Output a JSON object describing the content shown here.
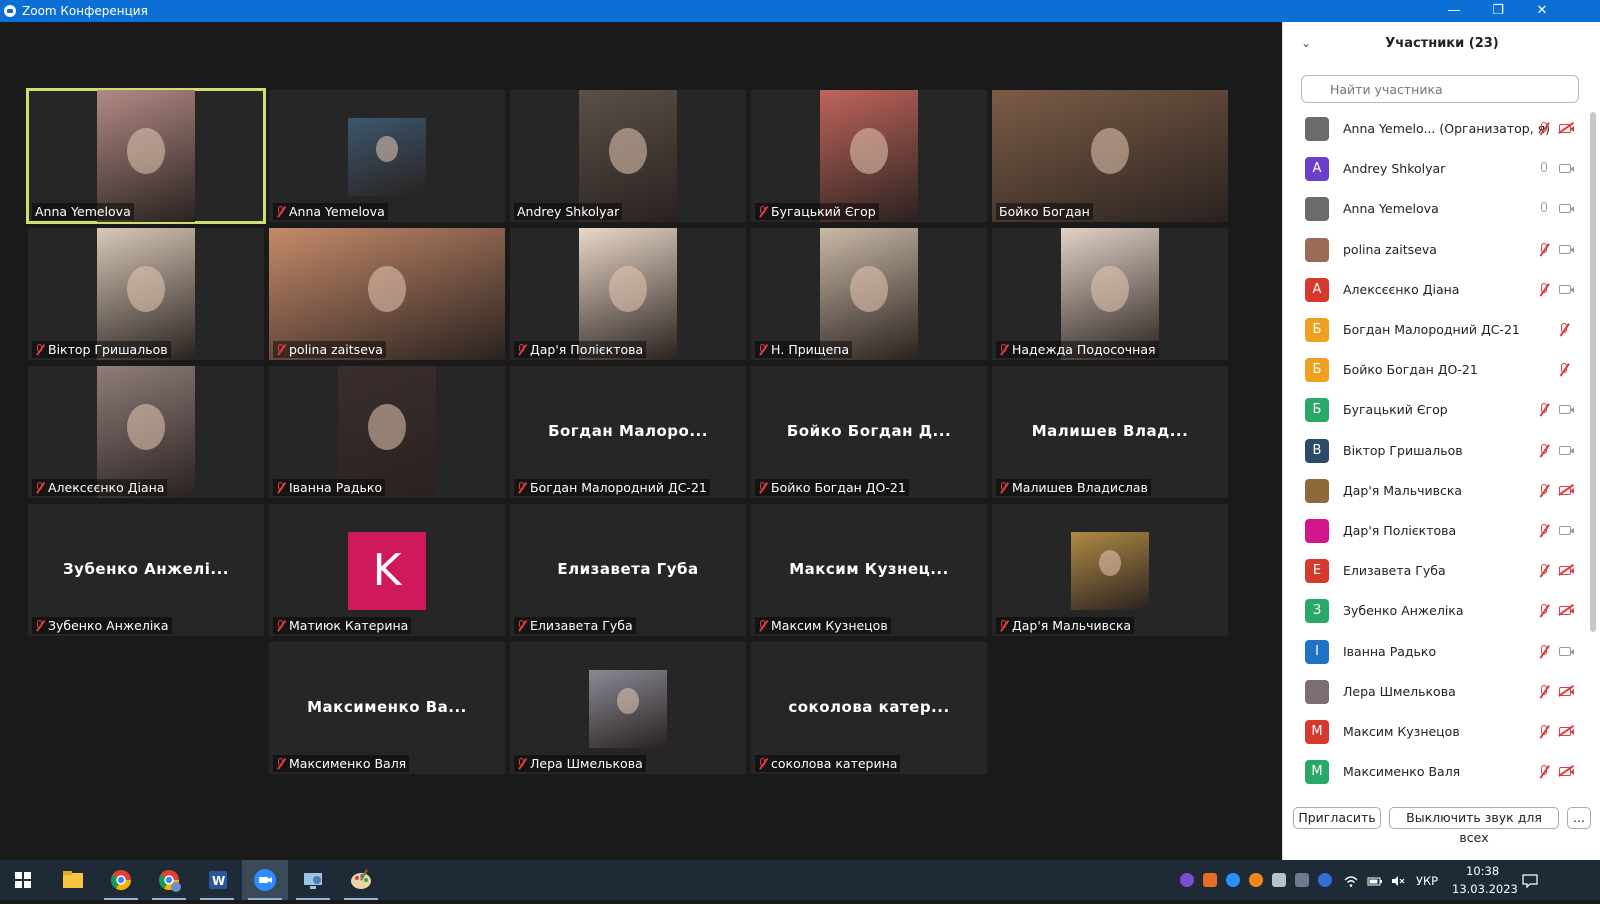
{
  "window": {
    "title": "Zoom Конференция",
    "minimize": "—",
    "restore": "❐",
    "close": "✕"
  },
  "gallery": [
    {
      "label": "Anna Yemelova",
      "muted": false,
      "video": true,
      "active": true,
      "photo_color": "#b28a85"
    },
    {
      "label": "Anna Yemelova",
      "muted": true,
      "video": true,
      "photo_color": "#3d5770",
      "small": true
    },
    {
      "label": "Andrey Shkolyar",
      "muted": false,
      "video": true,
      "photo_color": "#5a5048"
    },
    {
      "label": "Бугацький Єгор",
      "muted": true,
      "video": true,
      "photo_color": "#c0645c"
    },
    {
      "label": "Бойко Богдан",
      "muted": false,
      "video": true,
      "photo_color": "#7b5c46",
      "wide": true
    },
    {
      "label": "Віктор Гришальов",
      "muted": true,
      "video": true,
      "photo_color": "#d8c9b7"
    },
    {
      "label": "polina zaitseva",
      "muted": true,
      "video": true,
      "photo_color": "#c58a6a",
      "wide": true
    },
    {
      "label": "Дар'я Полієктова",
      "muted": true,
      "video": true,
      "photo_color": "#e9d8c8"
    },
    {
      "label": "Н. Прищепа",
      "muted": true,
      "video": true,
      "photo_color": "#c9b9a6"
    },
    {
      "label": "Надежда Подосочная",
      "muted": true,
      "video": true,
      "photo_color": "#e1d2c6"
    },
    {
      "label": "Алексєєнко Діана",
      "muted": true,
      "video": true,
      "photo_color": "#8f7d7a"
    },
    {
      "label": "Іванна Радько",
      "muted": true,
      "video": true,
      "photo_color": "#3a2e2b"
    },
    {
      "label": "Богдан Малородний ДС-21",
      "muted": true,
      "video": false,
      "display": "Богдан  Малоро..."
    },
    {
      "label": "Бойко Богдан ДО-21",
      "muted": true,
      "video": false,
      "display": "Бойко  Богдан  Д..."
    },
    {
      "label": "Малишев Владислав",
      "muted": true,
      "video": false,
      "display": "Малишев  Влад..."
    },
    {
      "label": "Зубенко Анжеліка",
      "muted": true,
      "video": false,
      "display": "Зубенко  Анжелі..."
    },
    {
      "label": "Матиюк Катерина",
      "muted": true,
      "video": false,
      "avatar": "K"
    },
    {
      "label": "Елизавета Губа",
      "muted": true,
      "video": false,
      "display": "Елизавета Губа"
    },
    {
      "label": "Максим Кузнецов",
      "muted": true,
      "video": false,
      "display": "Максим  Кузнец..."
    },
    {
      "label": "Дар'я Мальчивска",
      "muted": true,
      "video": false,
      "photo_color": "#b08a45",
      "small": true
    },
    {
      "label": "Максименко Валя",
      "muted": true,
      "video": false,
      "display": "Максименко  Ва..."
    },
    {
      "label": "Лера Шмелькова",
      "muted": true,
      "video": false,
      "photo_color": "#8a8a96",
      "small": true
    },
    {
      "label": "соколова катерина",
      "muted": true,
      "video": false,
      "display": "соколова  катер..."
    }
  ],
  "participants": {
    "header": "Участники (23)",
    "search_placeholder": "Найти участника",
    "list": [
      {
        "name": "Anna Yemelo...  (Организатор, я)",
        "initial": "",
        "color": "#6b6b6b",
        "mic": "muted",
        "cam": "off"
      },
      {
        "name": "Andrey Shkolyar",
        "initial": "A",
        "color": "#6a3fc9",
        "mic": "on",
        "cam": "on"
      },
      {
        "name": "Anna Yemelova",
        "initial": "",
        "color": "#6b6b6b",
        "mic": "on",
        "cam": "on"
      },
      {
        "name": "polina zaitseva",
        "initial": "",
        "color": "#9a6b55",
        "mic": "muted",
        "cam": "on"
      },
      {
        "name": "Алексєєнко Діана",
        "initial": "A",
        "color": "#d6392e",
        "mic": "muted",
        "cam": "on"
      },
      {
        "name": "Богдан Малородний ДС-21",
        "initial": "Б",
        "color": "#f0a020",
        "mic": "muted",
        "cam": "none"
      },
      {
        "name": "Бойко Богдан ДО-21",
        "initial": "Б",
        "color": "#f0a020",
        "mic": "muted",
        "cam": "none"
      },
      {
        "name": "Бугацький Єгор",
        "initial": "Б",
        "color": "#2aa86a",
        "mic": "muted",
        "cam": "on"
      },
      {
        "name": "Віктор Гришальов",
        "initial": "В",
        "color": "#2e4a6b",
        "mic": "muted",
        "cam": "on"
      },
      {
        "name": "Дар'я Мальчивска",
        "initial": "",
        "color": "#8c6a3a",
        "mic": "muted",
        "cam": "off"
      },
      {
        "name": "Дар'я Полієктова",
        "initial": "",
        "color": "#d3168c",
        "mic": "muted",
        "cam": "on"
      },
      {
        "name": "Елизавета Губа",
        "initial": "E",
        "color": "#d6392e",
        "mic": "muted",
        "cam": "off"
      },
      {
        "name": "Зубенко Анжеліка",
        "initial": "З",
        "color": "#2aa86a",
        "mic": "muted",
        "cam": "off"
      },
      {
        "name": "Іванна Радько",
        "initial": "І",
        "color": "#1f73c4",
        "mic": "muted",
        "cam": "on"
      },
      {
        "name": "Лера Шмелькова",
        "initial": "",
        "color": "#7b6d70",
        "mic": "muted",
        "cam": "off"
      },
      {
        "name": "Максим Кузнецов",
        "initial": "М",
        "color": "#d6392e",
        "mic": "muted",
        "cam": "off"
      },
      {
        "name": "Максименко Валя",
        "initial": "М",
        "color": "#2aa86a",
        "mic": "muted",
        "cam": "off"
      }
    ],
    "invite_label": "Пригласить",
    "mute_all_label": "Выключить звук для всех",
    "more_label": "..."
  },
  "taskbar": {
    "lang": "УКР",
    "time": "10:38",
    "date": "13.03.2023"
  }
}
